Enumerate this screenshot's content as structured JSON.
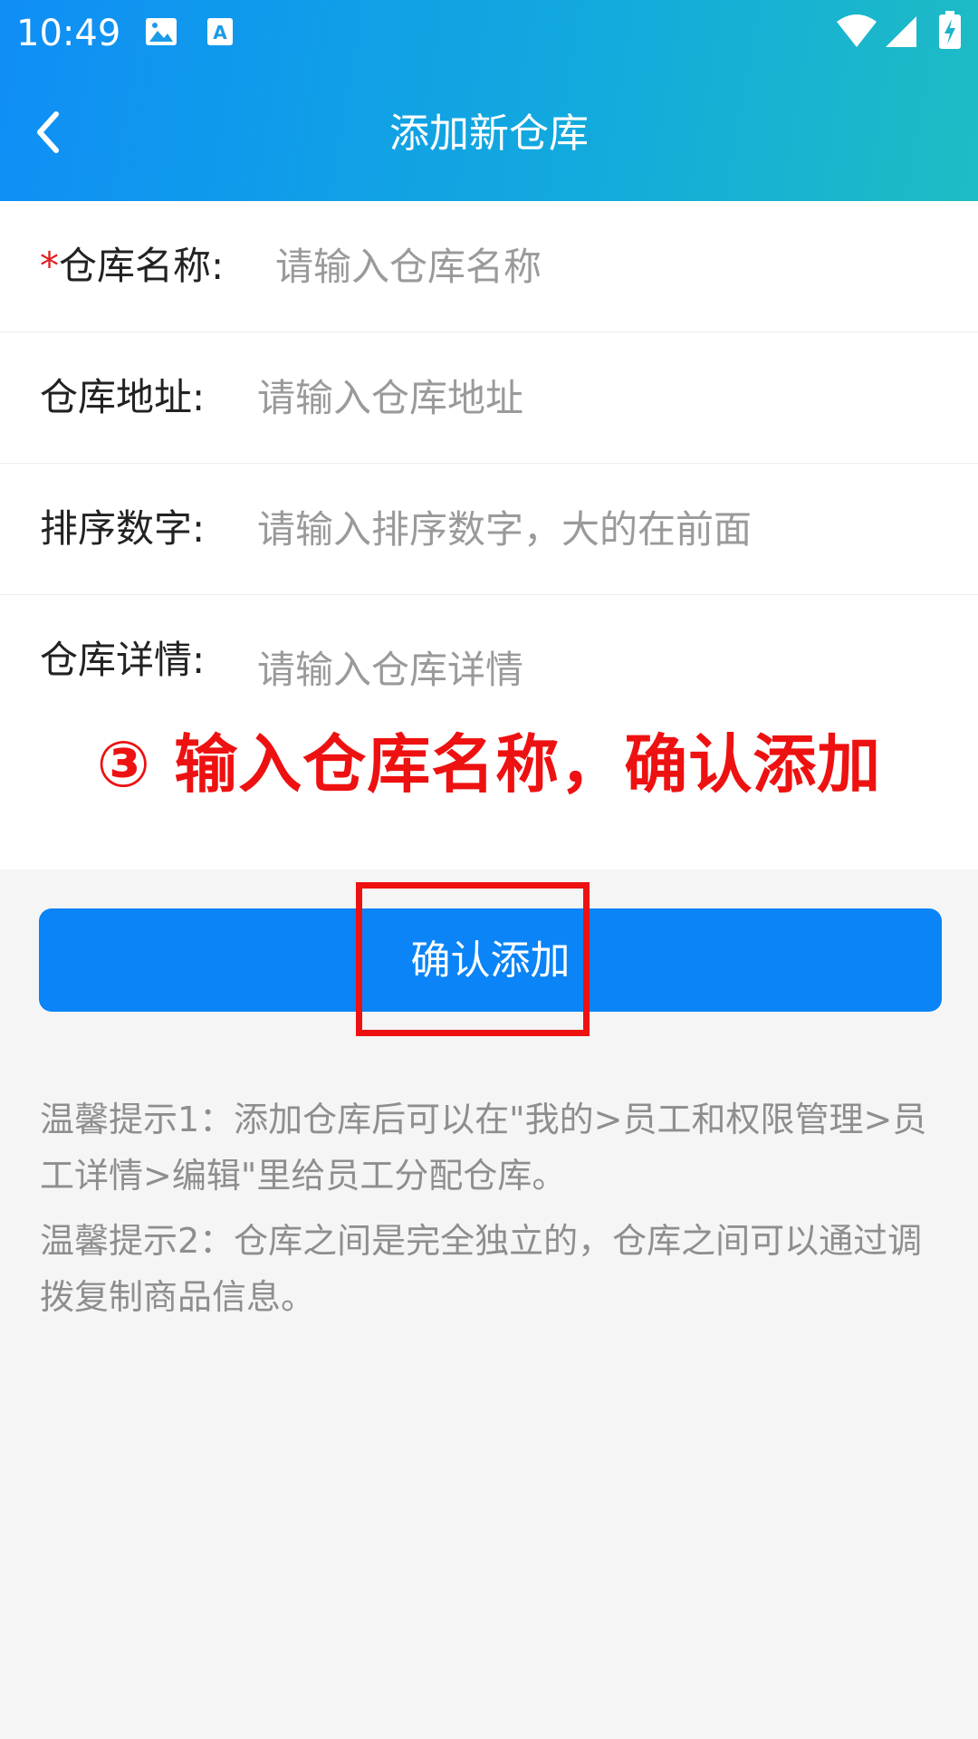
{
  "status_bar": {
    "time": "10:49",
    "icons": [
      "image-icon",
      "font-download-icon",
      "wifi-icon",
      "signal-icon",
      "battery-charging-icon"
    ]
  },
  "nav": {
    "title": "添加新仓库",
    "back_icon": "chevron-left-icon"
  },
  "form": {
    "rows": [
      {
        "required": true,
        "star": "*",
        "label": "仓库名称:",
        "placeholder": "请输入仓库名称",
        "value": ""
      },
      {
        "required": false,
        "label": "仓库地址:",
        "placeholder": "请输入仓库地址",
        "value": ""
      },
      {
        "required": false,
        "label": "排序数字:",
        "placeholder": "请输入排序数字，大的在前面",
        "value": ""
      },
      {
        "required": false,
        "label": "仓库详情:",
        "placeholder": "请输入仓库详情",
        "value": ""
      }
    ]
  },
  "annotation": {
    "text": "③ 输入仓库名称，确认添加",
    "color": "#ee1111"
  },
  "confirm_button": {
    "label": "确认添加",
    "color": "#0a84f7"
  },
  "tips": [
    "温馨提示1：添加仓库后可以在\"我的>员工和权限管理>员工详情>编辑\"里给员工分配仓库。",
    "温馨提示2：仓库之间是完全独立的，仓库之间可以通过调拨复制商品信息。"
  ],
  "colors": {
    "header_gradient_start": "#0f8ef6",
    "header_gradient_end": "#1ebcc4",
    "required_star": "#e02020",
    "placeholder": "#9a9a9a",
    "tip_text": "#8e8e8e"
  }
}
